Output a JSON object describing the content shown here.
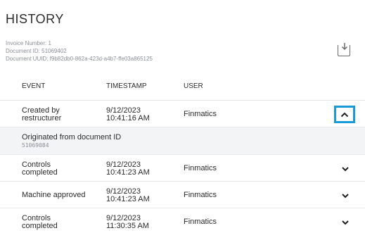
{
  "page": {
    "title": "HISTORY"
  },
  "meta": {
    "invoice_number": "Invoice Number: 1",
    "document_id": "Document ID: 51069402",
    "document_uuid": "Document UUID: f9b82db0-862a-423d-a4b7-ffe03a865125"
  },
  "toolbar": {
    "download_icon": "download-icon"
  },
  "table": {
    "headers": {
      "event": "EVENT",
      "timestamp": "TIMESTAMP",
      "user": "USER"
    },
    "rows": [
      {
        "event_l1": "Created by",
        "event_l2": "restructurer",
        "date": "9/12/2023",
        "time": "10:41:16 AM",
        "user": "Finmatics",
        "expanded": true
      },
      {
        "event_l1": "Controls",
        "event_l2": "completed",
        "date": "9/12/2023",
        "time": "10:41:23 AM",
        "user": "Finmatics",
        "expanded": false
      },
      {
        "event_l1": "Machine approved",
        "event_l2": "",
        "date": "9/12/2023",
        "time": "10:41:23 AM",
        "user": "Finmatics",
        "expanded": false
      },
      {
        "event_l1": "Controls",
        "event_l2": "completed",
        "date": "9/12/2023",
        "time": "11:30:35 AM",
        "user": "Finmatics",
        "expanded": false
      }
    ],
    "detail": {
      "label": "Originated from document ID",
      "value": "51069084"
    }
  },
  "colors": {
    "accent": "#1a9ad9",
    "muted": "#8a8f96",
    "detail_bg": "#f3f4f6"
  }
}
